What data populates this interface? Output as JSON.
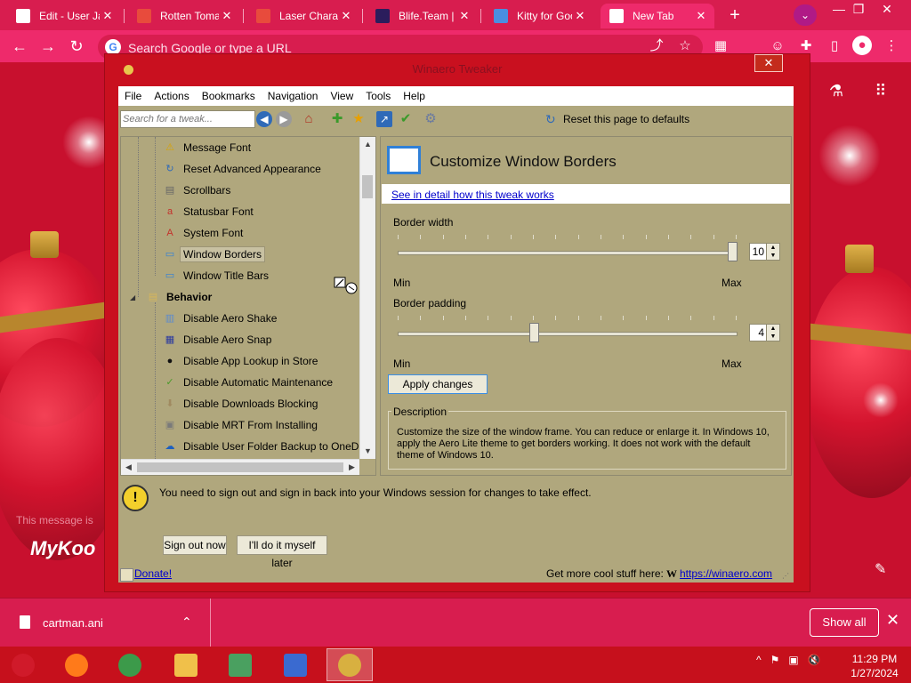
{
  "browser": {
    "tabs": [
      {
        "label": "Edit - User Ja",
        "fav": "#ffffff",
        "active": false
      },
      {
        "label": "Rotten Toma",
        "fav": "#e84b3c",
        "active": false
      },
      {
        "label": "Laser Charac",
        "fav": "#e84b3c",
        "active": false
      },
      {
        "label": "Blife.Team | b",
        "fav": "#2b1d5c",
        "active": false
      },
      {
        "label": "Kitty for Goo",
        "fav": "#4a8ee0",
        "active": false
      },
      {
        "label": "New Tab",
        "fav": "#ffffff",
        "active": true
      }
    ],
    "tab_close_glyph": "✕",
    "new_tab_glyph": "+",
    "profile_glyph": "⌄",
    "window_controls": [
      "—",
      "❐",
      "✕"
    ],
    "omnibox_placeholder": "Search Google or type a URL",
    "nav": {
      "back": "←",
      "forward": "→",
      "reload": "↻"
    },
    "toolbar_icons": [
      "share-icon",
      "star-icon",
      "extension-icon",
      "sidebar-icon",
      "profile-icon",
      "menu-icon"
    ]
  },
  "page": {
    "brand_text": "MyKoo",
    "faint_text": "This message is"
  },
  "app": {
    "title": "Winaero Tweaker",
    "close_glyph": "✕",
    "menu": [
      "File",
      "Actions",
      "Bookmarks",
      "Navigation",
      "View",
      "Tools",
      "Help"
    ],
    "search_placeholder": "Search for a tweak...",
    "reset_label": "Reset this page to defaults",
    "tree": [
      {
        "label": "Message Font",
        "icon": "warning-icon",
        "glyph": "⚠",
        "color": "#d9a300",
        "level": 2,
        "selected": false
      },
      {
        "label": "Reset Advanced Appearance",
        "icon": "reset-icon",
        "glyph": "↻",
        "color": "#2f6ab8",
        "level": 2,
        "selected": false
      },
      {
        "label": "Scrollbars",
        "icon": "scrollbars-icon",
        "glyph": "▤",
        "color": "#666666",
        "level": 2,
        "selected": false
      },
      {
        "label": "Statusbar Font",
        "icon": "font-icon",
        "glyph": "a",
        "color": "#c4302b",
        "level": 2,
        "selected": false
      },
      {
        "label": "System Font",
        "icon": "font-icon",
        "glyph": "A",
        "color": "#c4302b",
        "level": 2,
        "selected": false
      },
      {
        "label": "Window Borders",
        "icon": "window-icon",
        "glyph": "▭",
        "color": "#2f80d8",
        "level": 2,
        "selected": true
      },
      {
        "label": "Window Title Bars",
        "icon": "window-icon",
        "glyph": "▭",
        "color": "#2f80d8",
        "level": 2,
        "selected": false
      },
      {
        "label": "Behavior",
        "icon": "folder-icon",
        "glyph": "▤",
        "color": "#d6b65a",
        "level": 1,
        "selected": false,
        "bold": true
      },
      {
        "label": "Disable Aero Shake",
        "icon": "shake-icon",
        "glyph": "▥",
        "color": "#5a8ad0",
        "level": 2,
        "selected": false
      },
      {
        "label": "Disable Aero Snap",
        "icon": "snap-icon",
        "glyph": "▦",
        "color": "#2a3aa0",
        "level": 2,
        "selected": false
      },
      {
        "label": "Disable App Lookup in Store",
        "icon": "store-icon",
        "glyph": "●",
        "color": "#111111",
        "level": 2,
        "selected": false
      },
      {
        "label": "Disable Automatic Maintenance",
        "icon": "maintenance-icon",
        "glyph": "✓",
        "color": "#4a9a2a",
        "level": 2,
        "selected": false
      },
      {
        "label": "Disable Downloads Blocking",
        "icon": "downloads-icon",
        "glyph": "⬇",
        "color": "#a08a60",
        "level": 2,
        "selected": false
      },
      {
        "label": "Disable MRT From Installing",
        "icon": "mrt-icon",
        "glyph": "▣",
        "color": "#7a7a7a",
        "level": 2,
        "selected": false
      },
      {
        "label": "Disable User Folder Backup to OneDrive",
        "icon": "onedrive-icon",
        "glyph": "☁",
        "color": "#1c5fbf",
        "level": 2,
        "selected": false
      }
    ],
    "panel": {
      "title": "Customize Window Borders",
      "detail_link": "See in detail how this tweak works",
      "border_width": {
        "label": "Border width",
        "value": "10",
        "min_label": "Min",
        "max_label": "Max",
        "level": 1.0
      },
      "border_padding": {
        "label": "Border padding",
        "value": "4",
        "min_label": "Min",
        "max_label": "Max",
        "level": 0.4
      },
      "apply_label": "Apply changes",
      "description_legend": "Description",
      "description_text": "Customize the size of the window frame. You can reduce or enlarge it. In Windows 10, apply the Aero Lite theme to get borders working. It does not work with the default theme of Windows 10."
    },
    "warning_text": "You need to sign out and sign in back into your Windows session for changes to take effect.",
    "sign_out_label": "Sign out now",
    "later_label": "I'll do it myself later",
    "donate_label": "Donate!",
    "more_text": "Get more cool stuff here:",
    "winaero_icon_text": "W",
    "winaero_link": "https://winaero.com"
  },
  "downloads": {
    "filename": "cartman.ani",
    "show_all_label": "Show all",
    "chevron": "⌃",
    "close_glyph": "✕"
  },
  "taskbar": {
    "apps": [
      {
        "name": "start-button",
        "color": "#d01a2a",
        "active": false
      },
      {
        "name": "firefox-icon",
        "color": "#ff7a1a",
        "active": false
      },
      {
        "name": "chrome-icon",
        "color": "#3c9a4a",
        "active": false
      },
      {
        "name": "file-explorer-icon",
        "color": "#f0c04a",
        "active": false
      },
      {
        "name": "network-icon",
        "color": "#4aa060",
        "active": false
      },
      {
        "name": "remote-desktop-icon",
        "color": "#3a6ad0",
        "active": false
      },
      {
        "name": "winaero-tweaker-icon",
        "color": "#d8b040",
        "active": true
      }
    ],
    "time": "11:29 PM",
    "date": "1/27/2024",
    "tray": [
      "^",
      "⚑",
      "▣",
      "🔇"
    ]
  }
}
